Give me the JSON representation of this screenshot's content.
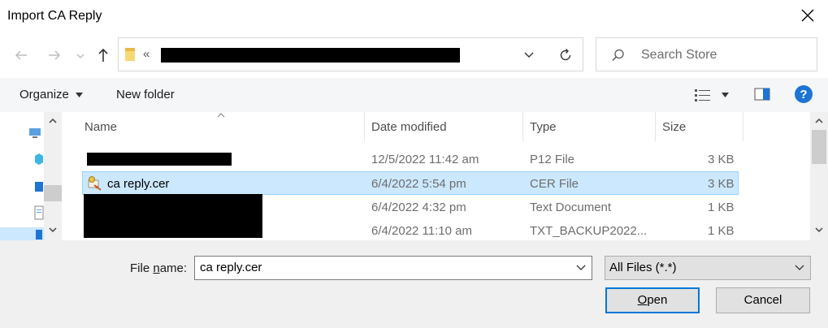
{
  "window": {
    "title": "Import CA Reply"
  },
  "address": {
    "chevron_text": "«"
  },
  "search": {
    "placeholder": "Search Store"
  },
  "toolbar": {
    "organize_label": "Organize",
    "new_folder_label": "New folder"
  },
  "columns": {
    "name": "Name",
    "date": "Date modified",
    "type": "Type",
    "size": "Size"
  },
  "files": [
    {
      "name": "",
      "date": "12/5/2022 11:42 am",
      "type": "P12 File",
      "size": "3 KB",
      "selected": false
    },
    {
      "name": "ca reply.cer",
      "date": "6/4/2022 5:54 pm",
      "type": "CER File",
      "size": "3 KB",
      "selected": true
    },
    {
      "name": "",
      "date": "6/4/2022 4:32 pm",
      "type": "Text Document",
      "size": "1 KB",
      "selected": false
    },
    {
      "name": "",
      "date": "6/4/2022 11:10 am",
      "type": "TXT_BACKUP2022...",
      "size": "1 KB",
      "selected": false
    }
  ],
  "footer": {
    "file_name_label_pre": "File ",
    "file_name_label_u": "n",
    "file_name_label_post": "ame:",
    "file_name_value": "ca reply.cer",
    "filter_value": "All Files (*.*)",
    "open_u": "O",
    "open_rest": "pen",
    "cancel_label": "Cancel"
  },
  "colors": {
    "selection": "#cce8ff",
    "selection_border": "#99d1ff",
    "accent": "#0078d7",
    "help_icon": "#1e74d3"
  }
}
